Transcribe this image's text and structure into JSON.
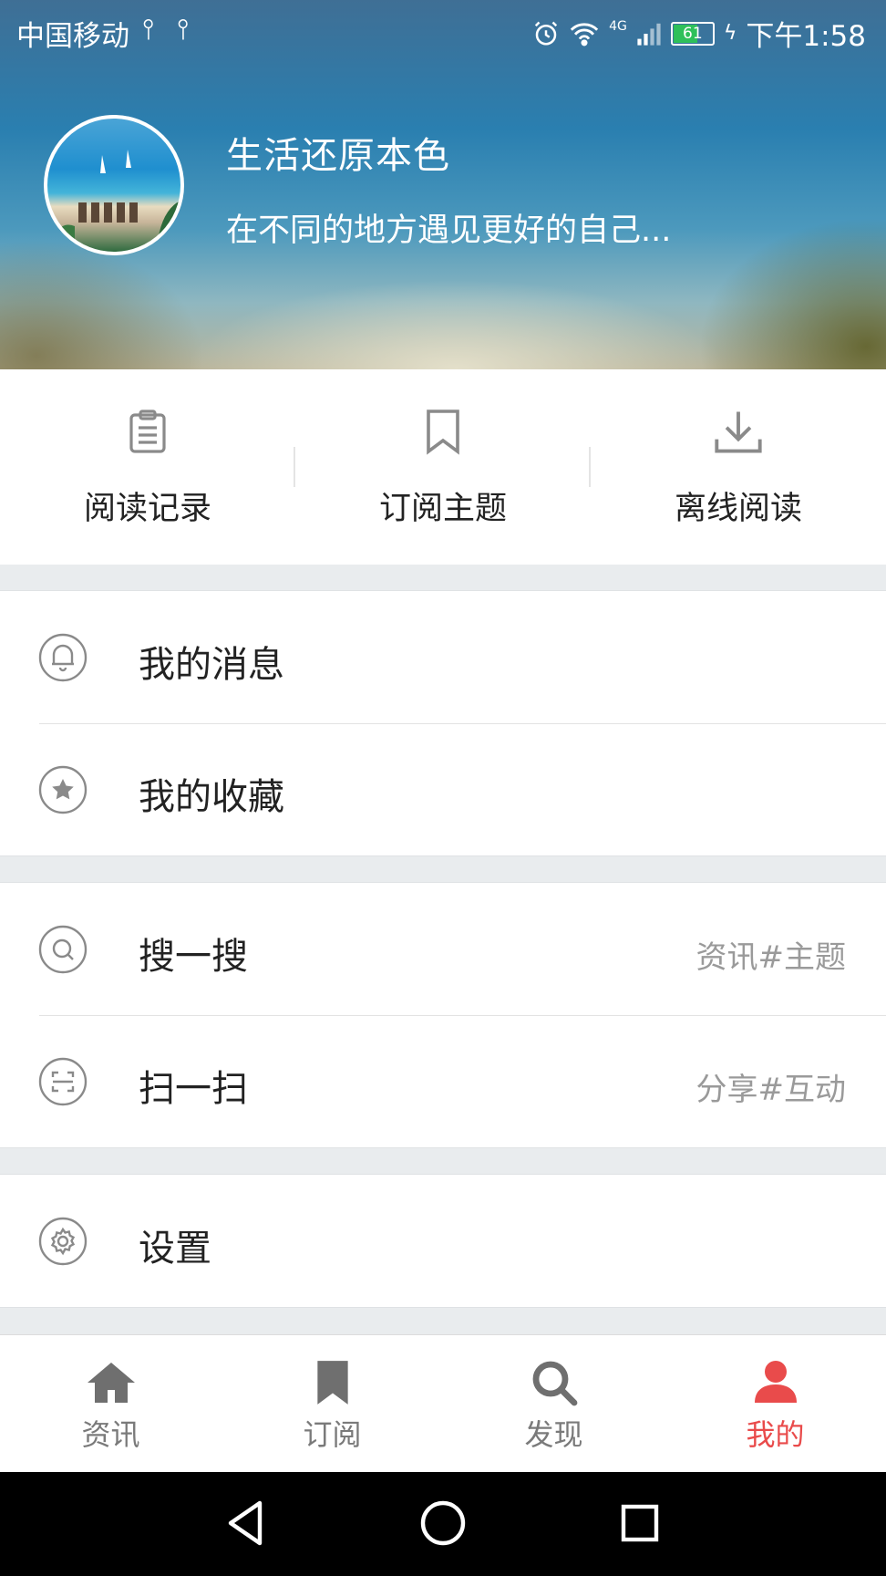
{
  "status_bar": {
    "carrier": "中国移动",
    "network": "4G",
    "battery": "61",
    "time": "下午1:58"
  },
  "profile": {
    "name": "生活还原本色",
    "motto": "在不同的地方遇见更好的自己..."
  },
  "quick_actions": [
    {
      "label": "阅读记录",
      "icon": "clipboard-icon"
    },
    {
      "label": "订阅主题",
      "icon": "bookmark-outline-icon"
    },
    {
      "label": "离线阅读",
      "icon": "download-icon"
    }
  ],
  "menu": {
    "messages": {
      "label": "我的消息",
      "icon": "bell-icon"
    },
    "favorites": {
      "label": "我的收藏",
      "icon": "star-icon"
    },
    "search": {
      "label": "搜一搜",
      "hint": "资讯#主题",
      "icon": "search-icon"
    },
    "scan": {
      "label": "扫一扫",
      "hint": "分享#互动",
      "icon": "scan-icon"
    },
    "settings": {
      "label": "设置",
      "icon": "gear-icon"
    }
  },
  "tabs": [
    {
      "label": "资讯",
      "icon": "home-icon",
      "active": false
    },
    {
      "label": "订阅",
      "icon": "bookmark-icon",
      "active": false
    },
    {
      "label": "发现",
      "icon": "search-icon",
      "active": false
    },
    {
      "label": "我的",
      "icon": "person-icon",
      "active": true
    }
  ],
  "colors": {
    "accent": "#e94b4b",
    "icon_gray": "#8a8a8a",
    "separator": "#e9ecee"
  }
}
